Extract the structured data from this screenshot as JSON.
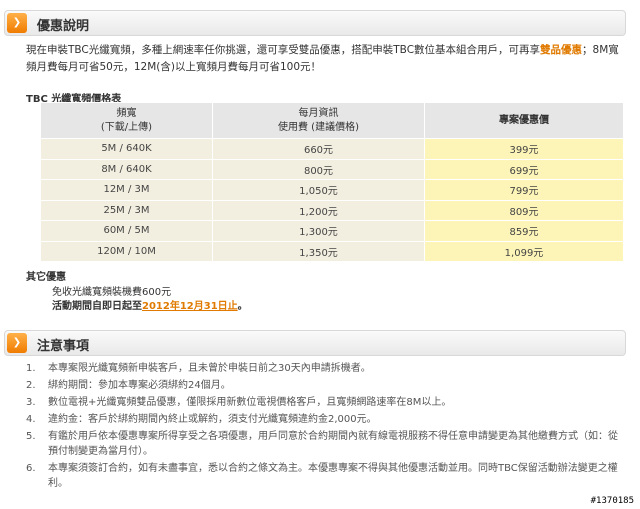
{
  "section1": {
    "icon": "chevron-right-icon",
    "title": "優惠說明"
  },
  "intro": {
    "text_before": "現在申裝TBC光纖寬頻，多種上網速率任你挑選，還可享受雙品優惠，搭配申裝TBC數位基本組合用戶，可再享",
    "highlight": "雙品優惠",
    "text_after": "；8M寬頻月費每月可省50元，12M(含)以上寬頻月費每月可省100元！"
  },
  "table": {
    "title": "TBC 光纖寬頻價格表",
    "headers": [
      {
        "line1": "頻寬",
        "line2": "(下載/上傳)"
      },
      {
        "line1": "每月資訊",
        "line2": "使用費 (建議價格)"
      },
      {
        "line1": "專案優惠價",
        "line2": ""
      }
    ],
    "rows": [
      {
        "bandwidth": "5M / 640K",
        "regular": "660元",
        "promo": "399元"
      },
      {
        "bandwidth": "8M / 640K",
        "regular": "800元",
        "promo": "699元"
      },
      {
        "bandwidth": "12M / 3M",
        "regular": "1,050元",
        "promo": "799元"
      },
      {
        "bandwidth": "25M / 3M",
        "regular": "1,200元",
        "promo": "809元"
      },
      {
        "bandwidth": "60M / 5M",
        "regular": "1,300元",
        "promo": "859元"
      },
      {
        "bandwidth": "120M / 10M",
        "regular": "1,350元",
        "promo": "1,099元"
      }
    ]
  },
  "others": {
    "title": "其它優惠",
    "item1": "免收光纖寬頻裝機費600元",
    "item2_prefix": "活動期間自即日起至",
    "item2_date": "2012年12月31日止",
    "item2_suffix": "。"
  },
  "section2": {
    "icon": "chevron-right-icon",
    "title": "注意事項"
  },
  "notes": [
    {
      "num": "1.",
      "text": "本專案限光纖寬頻新申裝客戶，且未曾於申裝日前之30天內申請拆機者。"
    },
    {
      "num": "2.",
      "text": "綁約期間：參加本專案必須綁約24個月。"
    },
    {
      "num": "3.",
      "text": "數位電視+光纖寬頻雙品優惠，僅限採用新數位電視價格客戶，且寬頻網路速率在8M以上。"
    },
    {
      "num": "4.",
      "text": "違約金：客戶於綁約期間內終止或解約，須支付光纖寬頻違約金2,000元。"
    },
    {
      "num": "5.",
      "text": "有鑑於用戶依本優惠專案所得享受之各項優惠，用戶同意於合約期間內就有線電視服務不得任意申請變更為其他繳費方式（如：從預付制變更為當月付）。"
    },
    {
      "num": "6.",
      "text": "本專案須簽訂合約，如有未盡事宜，悉以合約之條文為主。本優惠專案不得與其他優惠活動並用。同時TBC保留活動辦法變更之權利。"
    }
  ],
  "watermark": "#1370185"
}
